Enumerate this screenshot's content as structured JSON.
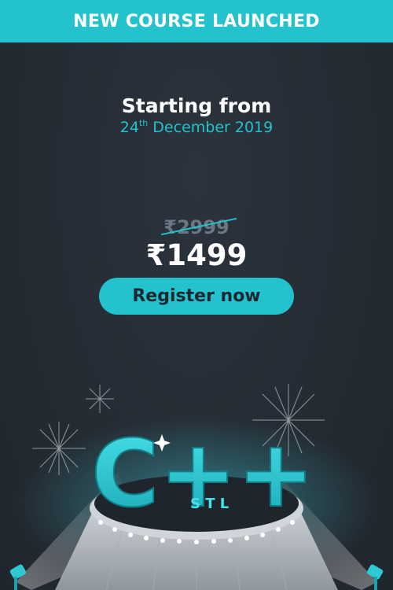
{
  "banner": {
    "text": "NEW COURSE LAUNCHED"
  },
  "launch": {
    "title": "Starting from",
    "date_day": "24",
    "date_suffix": "th",
    "date_rest": "December 2019"
  },
  "pricing": {
    "old_price": "₹2999",
    "new_price": "₹1499"
  },
  "cta": {
    "label": "Register now"
  },
  "illustration": {
    "logo_text": "C++",
    "sub_text": "S T L"
  },
  "colors": {
    "accent": "#23c2cc",
    "background": "#262d36",
    "text_primary": "#ffffff",
    "strike_price": "#6b7784"
  }
}
